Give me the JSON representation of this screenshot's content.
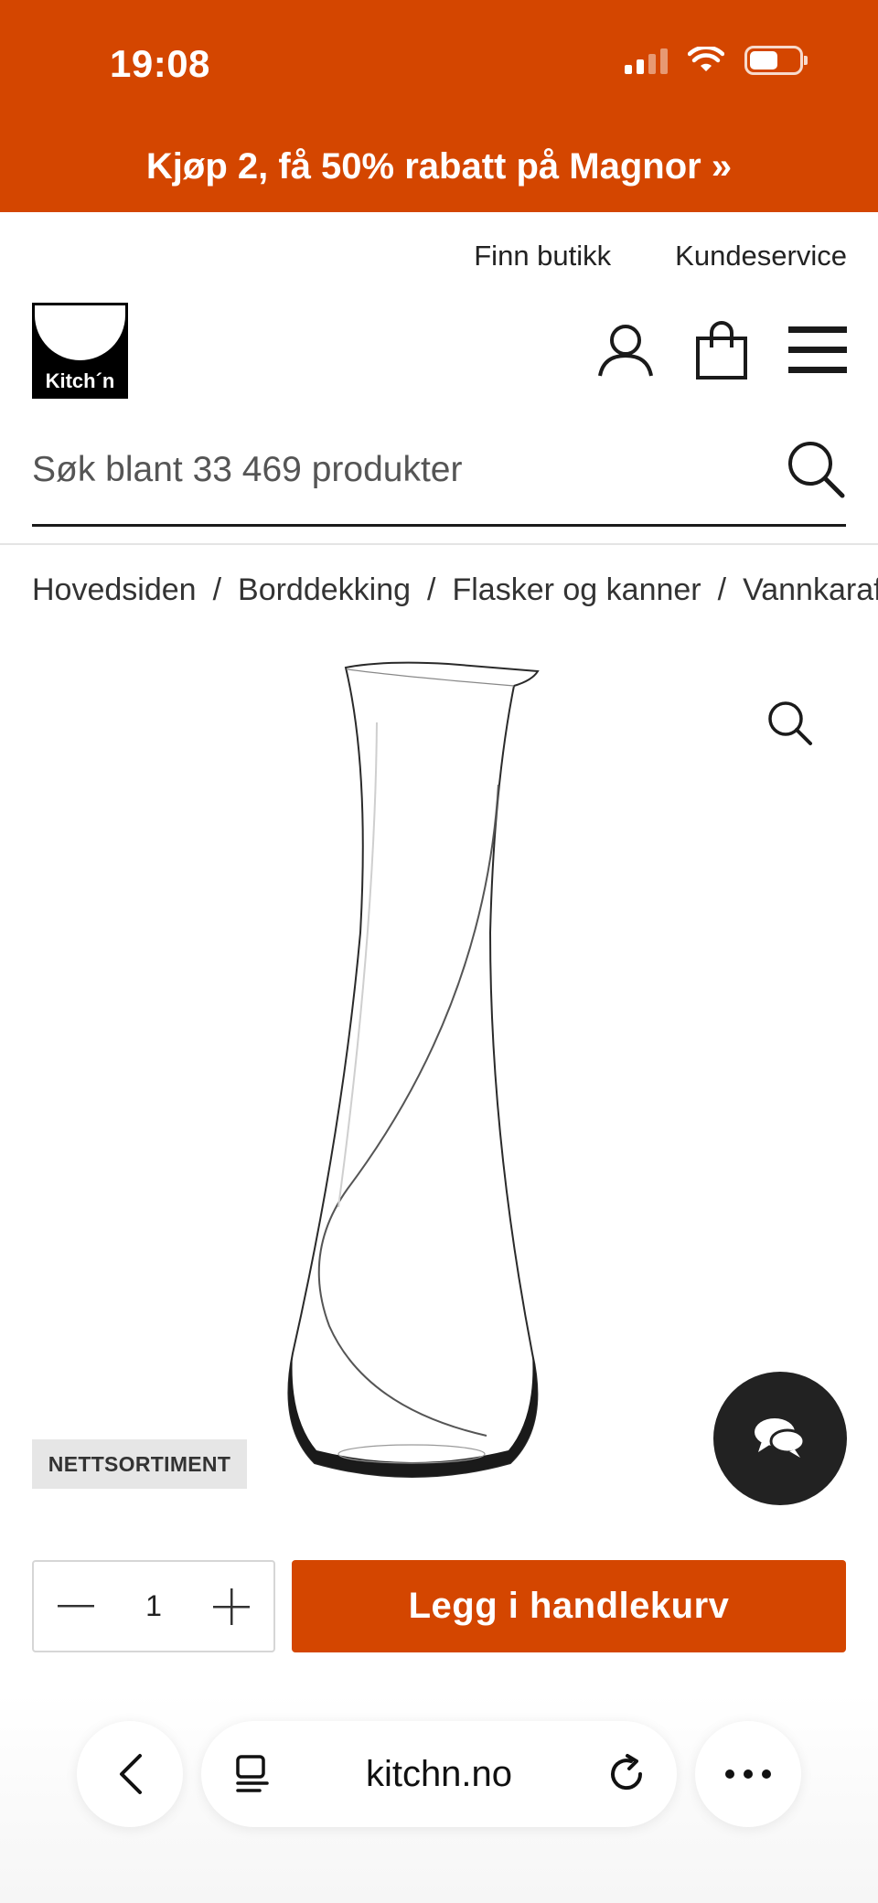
{
  "status_bar": {
    "time": "19:08"
  },
  "promo": {
    "text": "Kjøp 2, få 50% rabatt på Magnor »"
  },
  "utility_links": {
    "find_store": "Finn butikk",
    "customer_service": "Kundeservice"
  },
  "logo": {
    "text": "Kitch´n"
  },
  "search": {
    "placeholder": "Søk blant 33 469 produkter"
  },
  "breadcrumb": [
    "Hovedsiden",
    "Borddekking",
    "Flasker og kanner",
    "Vannkaraffel"
  ],
  "breadcrumb_separator": "/",
  "product": {
    "badge": "NETTSORTIMENT"
  },
  "cart": {
    "quantity": "1",
    "add_label": "Legg i handlekurv"
  },
  "browser": {
    "url": "kitchn.no"
  },
  "colors": {
    "brand": "#d44600",
    "dark": "#222222"
  }
}
